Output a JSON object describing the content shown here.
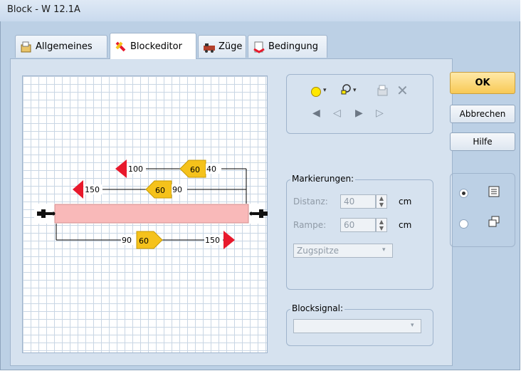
{
  "window": {
    "title": "Block - W 12.1A"
  },
  "tabs": [
    {
      "label": "Allgemeines",
      "icon": "properties-icon"
    },
    {
      "label": "Blockeditor",
      "icon": "block-editor-icon"
    },
    {
      "label": "Züge",
      "icon": "trains-icon"
    },
    {
      "label": "Bedingung",
      "icon": "condition-icon"
    }
  ],
  "editor": {
    "signals": {
      "row1": {
        "stop_value": "100",
        "speed_value": "60",
        "speed_suffix": "40"
      },
      "row2": {
        "stop_value": "150",
        "speed_value": "60",
        "speed_suffix": "90"
      },
      "row3": {
        "speed_prefix": "90",
        "speed_value": "60",
        "stop_value": "150"
      }
    }
  },
  "markierungen": {
    "legend": "Markierungen:",
    "distanz_label": "Distanz:",
    "distanz_value": "40",
    "distanz_unit": "cm",
    "rampe_label": "Rampe:",
    "rampe_value": "60",
    "rampe_unit": "cm",
    "zug_value": "Zugspitze"
  },
  "blocksignal": {
    "legend": "Blocksignal:",
    "value": ""
  },
  "buttons": {
    "ok": "OK",
    "abbrechen": "Abbrechen",
    "hilfe": "Hilfe"
  },
  "colors": {
    "track": "#f9b9b9",
    "stop_sign": "#e8192c",
    "speed_sign": "#f5c21b",
    "ok_button": "#f8c955"
  }
}
